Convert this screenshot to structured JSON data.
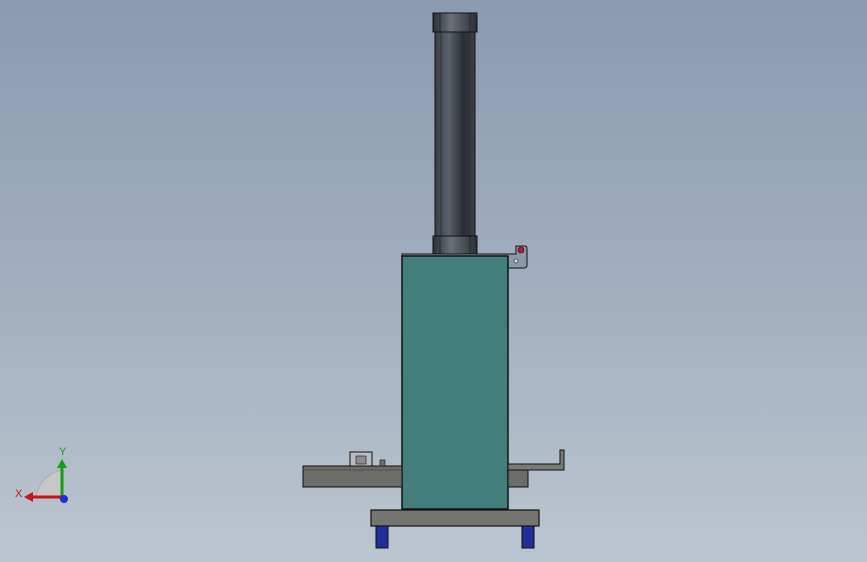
{
  "scene": {
    "background_top": "#8a9bb0",
    "background_bottom": "#bcc6d0"
  },
  "colors": {
    "cylinder_dark": "#2f343a",
    "cylinder_mid": "#4a5058",
    "cylinder_light": "#6a7078",
    "housing_teal": "#427f7c",
    "base_gray": "#6c6c68",
    "plate_gray": "#75756f",
    "foot_blue": "#1f2f9c",
    "indicator_red": "#c0182a",
    "outline": "#111111"
  },
  "triad": {
    "x_label": "X",
    "y_label": "Y",
    "x_color": "#c01818",
    "y_color": "#10a010",
    "z_color": "#1a30d8"
  }
}
